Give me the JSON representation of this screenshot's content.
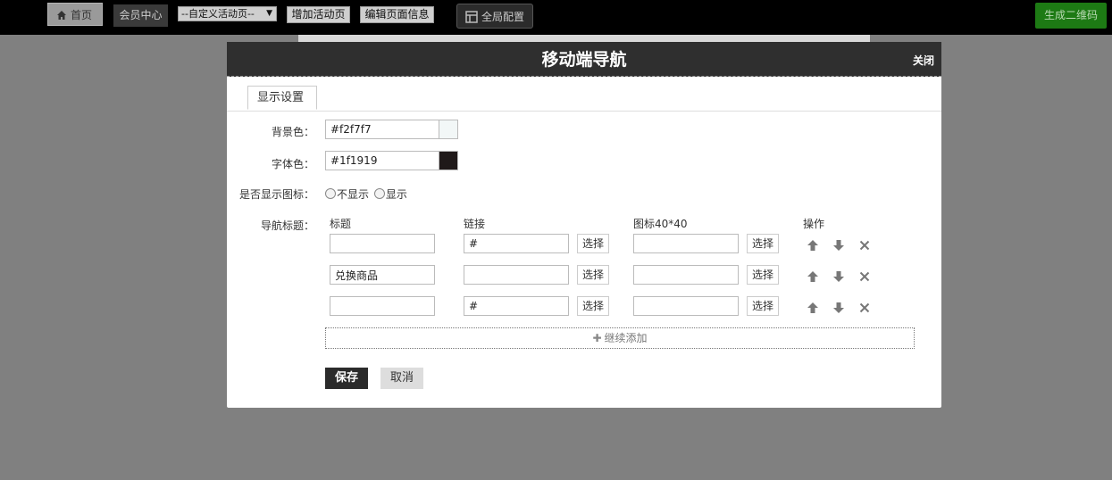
{
  "topbar": {
    "home_label": "首页",
    "member_label": "会员中心",
    "page_select_value": "--自定义活动页--",
    "add_page_label": "增加活动页",
    "edit_page_label": "编辑页面信息",
    "global_config_label": "全局配置",
    "qr_label": "生成二维码"
  },
  "modal": {
    "title": "移动端导航",
    "close_label": "关闭",
    "tab_label": "显示设置",
    "bg_color": {
      "label": "背景色：",
      "value": "#f2f7f7",
      "swatch": "#f2f7f7"
    },
    "font_color": {
      "label": "字体色：",
      "value": "#1f1919",
      "swatch": "#1f1919"
    },
    "show_icon": {
      "label": "是否显示图标：",
      "option_hide": "不显示",
      "option_show": "显示"
    },
    "nav": {
      "label": "导航标题：",
      "col_title": "标题",
      "col_link": "链接",
      "col_icon": "图标40*40",
      "col_ops": "操作",
      "pick_label": "选择",
      "rows": [
        {
          "title": "",
          "link": "#",
          "icon": ""
        },
        {
          "title": "兑换商品",
          "link": "",
          "icon": ""
        },
        {
          "title": "",
          "link": "#",
          "icon": ""
        }
      ]
    },
    "add_more_label": "继续添加",
    "save_label": "保存",
    "cancel_label": "取消"
  }
}
